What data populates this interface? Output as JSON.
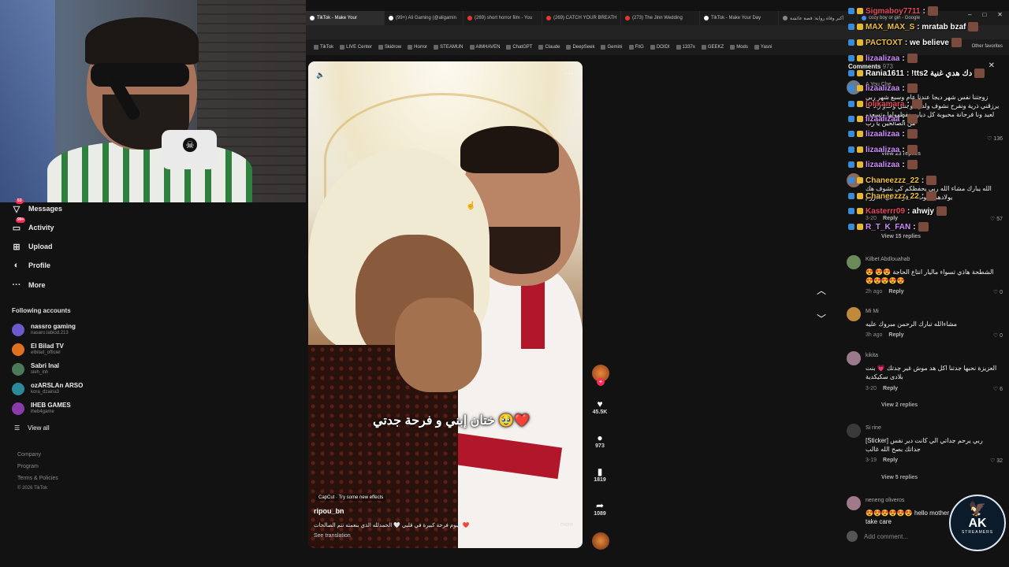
{
  "browser": {
    "tabs": [
      {
        "label": "TikTok - Make Your",
        "active": true
      },
      {
        "label": "(99+) Ali Gaming (@aligamin"
      },
      {
        "label": "(269) short horror film - You"
      },
      {
        "label": "(269) CATCH YOUR BREATH"
      },
      {
        "label": "(273) The Jinn Wedding"
      },
      {
        "label": "TikTok - Make Your Day"
      },
      {
        "label": "أكبر وفاة رواية: قصة عائشة"
      },
      {
        "label": "cozy boy or girl - Google"
      }
    ],
    "bookmarks": [
      "TikTok",
      "LIVE Center",
      "Skidrow",
      "Horror",
      "STEAMUN",
      "AIMHAVEN",
      "ChatGPT",
      "Claude",
      "DeepSeek",
      "Gemini",
      "FitG",
      "DOIDI",
      "1337x",
      "GEEKZ",
      "Mods",
      "Yasni"
    ],
    "other_favorites": "Other favorites",
    "window_controls": [
      "–",
      "□",
      "✕"
    ]
  },
  "sidebar": {
    "nav": [
      {
        "label": "Messages",
        "icon": "send-icon",
        "badge": "53"
      },
      {
        "label": "Activity",
        "icon": "activity-icon",
        "badge": "99+"
      },
      {
        "label": "Upload",
        "icon": "upload-icon"
      },
      {
        "label": "Profile",
        "icon": "profile-icon"
      },
      {
        "label": "More",
        "icon": "more-icon"
      }
    ],
    "following_title": "Following accounts",
    "following": [
      {
        "name": "nassro gaming",
        "handle": "nasaro.labiod.213",
        "color": "#6a5acd"
      },
      {
        "name": "El Bilad TV",
        "handle": "elbilad_officiel",
        "color": "#e07020"
      },
      {
        "name": "Sabri Inal",
        "handle": "sleh_inh",
        "color": "#4a7a5a"
      },
      {
        "name": "ozARSLAn ARSO",
        "handle": "kora_dzairia3",
        "color": "#2a8a9a"
      },
      {
        "name": "IHEB GAMES",
        "handle": "iheb4game",
        "color": "#8a3aaa"
      }
    ],
    "view_all": "View all",
    "footer": [
      "Company",
      "Program",
      "Terms & Policies",
      "© 2026 TikTok"
    ]
  },
  "video": {
    "caption_overlay": "ختان إبني و فرحة جدتي 🥹❤️",
    "capcut": "CapCut · Try some new effects",
    "username": "ripou_bn",
    "description": "اليوم فرحة كبيرة في قلبي 🤍 الحمدلله الذي بنعمته تتم الصالحات ❤️...",
    "more": "more",
    "see_translation": "See translation"
  },
  "actions": {
    "likes": "45.5K",
    "comments": "973",
    "saves": "1819",
    "shares": "1089"
  },
  "comments_panel": {
    "title": "Comments",
    "count": "973",
    "items": [
      {
        "user": "A You Che",
        "text": "زوجتنا نفس شهر ديجا عندنا عام وسبع شهر ربي يرزقني ذرية ونفرح نشوف ولدي او بنتي وحدو زاد جا لعيد ونا فرحانة محبوبة كل ديار يحفظهولها وتسعدو من الصالحين يا رب",
        "meta": "",
        "reply": "Reply",
        "likes": "136",
        "color": "#6a7a8a"
      },
      {
        "user": "",
        "text": "الله يبارك مشاء الله ربي يحفظكم كي نشوف هك يولادهم نموت ... فرحة كل محروم",
        "meta": "3-20",
        "reply": "Reply",
        "likes": "57",
        "color": "#8a6a5a"
      },
      {
        "user": "Kilbet Abdlouahab",
        "text": "الشطحة هاذي تسواء ماليار انتاع الحاجة 😍😍 😍😍😍😍😍😍",
        "meta": "2h ago",
        "reply": "Reply",
        "likes": "0",
        "color": "#6a8a5a"
      },
      {
        "user": "Mi Mi",
        "text": "مشاءالله تبارك الرحمن مبروك عليه",
        "meta": "3h ago",
        "reply": "Reply",
        "likes": "0",
        "color": "#c08a3a"
      },
      {
        "user": "kikita",
        "text": "العزيزة نحبها جدتنا اكل هد موش غير جدتك 💗 بنت بلادى سكيكدية",
        "meta": "3-20",
        "reply": "Reply",
        "likes": "6",
        "color": "#9a7a8a"
      },
      {
        "user": "Si rine",
        "text": "ربي يرحم جداتي الي كانت دير نفس [Sticker] جداتك بصح الله غالب",
        "meta": "3-19",
        "reply": "Reply",
        "likes": "32",
        "color": "#3a3a3a"
      },
      {
        "user": "neneng oliveros",
        "text": "😍😍😍😍😍😍 hello mother take care",
        "meta": "",
        "reply": "",
        "likes": "",
        "color": "#a07a8a"
      }
    ],
    "view_replies": [
      "View 23 replies",
      "View 15 replies",
      "View 2 replies",
      "View 5 replies"
    ],
    "add_comment": "Add comment..."
  },
  "chat": [
    {
      "name": "Sigmaboy7711",
      "msg": ":",
      "color": "#e84a5a"
    },
    {
      "name": "MAX_MAX_S",
      "msg": ": mratab bzaf",
      "color": "#f0c040"
    },
    {
      "name": "PACTOXT",
      "msg": ": we believe",
      "color": "#f0c040"
    },
    {
      "name": "lizaalizaa",
      "msg": ":",
      "color": "#d18cff"
    },
    {
      "name": "Rania1611",
      "msg": ": !tts2 دك هدي غنية",
      "color": "#ffffff"
    },
    {
      "name": "lizaalizaa",
      "msg": ":",
      "color": "#d18cff"
    },
    {
      "name": "lolikamara",
      "msg": ":",
      "color": "#e84a5a"
    },
    {
      "name": "lizaalizaa",
      "msg": ":",
      "color": "#d18cff"
    },
    {
      "name": "lizaalizaa",
      "msg": ":",
      "color": "#d18cff"
    },
    {
      "name": "lizaalizaa",
      "msg": ":",
      "color": "#d18cff"
    },
    {
      "name": "lizaalizaa",
      "msg": ":",
      "color": "#d18cff"
    },
    {
      "name": "Chaneezzz_22",
      "msg": ":",
      "color": "#f0c040"
    },
    {
      "name": "Chaneezzz_22",
      "msg": ":",
      "color": "#f0c040"
    },
    {
      "name": "Kasterrr09",
      "msg": ": ahwjy",
      "color": "#e84a5a"
    },
    {
      "name": "R_T_K_FAN",
      "msg": ":",
      "color": "#d18cff"
    }
  ],
  "logo": {
    "text": "AK",
    "sub": "STREAMERS"
  }
}
